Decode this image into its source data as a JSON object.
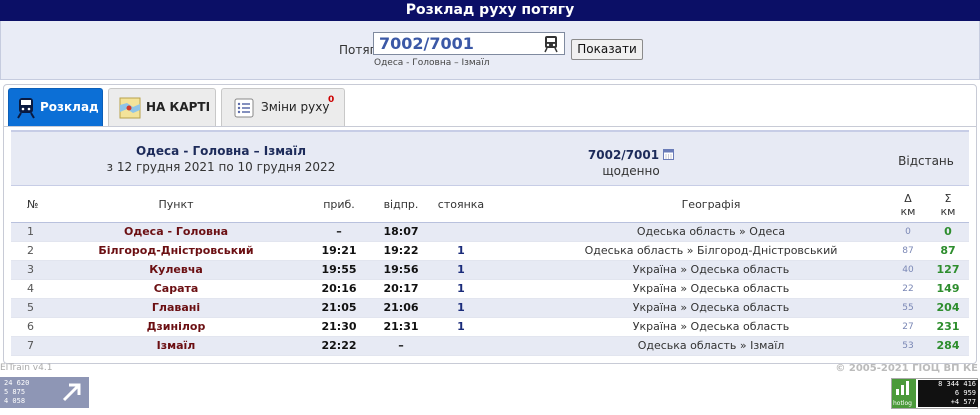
{
  "header": {
    "title": "Розклад руху потягу"
  },
  "search": {
    "label": "Потяг",
    "value": "7002/7001",
    "subtitle": "Одеса - Головна – Ізмаїл",
    "button": "Показати"
  },
  "tabs": [
    {
      "label": "Розклад",
      "icon": "train-icon",
      "active": true
    },
    {
      "label": "НА КАРТІ",
      "icon": "map-icon",
      "active": false
    },
    {
      "label": "Зміни руху",
      "icon": "list-icon",
      "active": false,
      "badge": "0"
    }
  ],
  "schedule": {
    "route": "Одеса - Головна – Ізмаїл",
    "period": "з 12 грудня 2021 по 10 грудня 2022",
    "train_number": "7002/7001",
    "frequency": "щоденно",
    "distance_header": "Відстань"
  },
  "columns": {
    "num": "№",
    "station": "Пункт",
    "arrival": "приб.",
    "departure": "відпр.",
    "stop": "стоянка",
    "geography": "Географія",
    "delta": "Δ",
    "delta_unit": "км",
    "sum": "Σ",
    "sum_unit": "км"
  },
  "rows": [
    {
      "n": "1",
      "station": "Одеса - Головна",
      "arr": "–",
      "dep": "18:07",
      "stop": "",
      "geo": "Одеська область » Одеса",
      "dkm": "0",
      "skm": "0"
    },
    {
      "n": "2",
      "station": "Білгород-Дністровський",
      "arr": "19:21",
      "dep": "19:22",
      "stop": "1",
      "geo": "Одеська область » Білгород-Дністровський",
      "dkm": "87",
      "skm": "87"
    },
    {
      "n": "3",
      "station": "Кулевча",
      "arr": "19:55",
      "dep": "19:56",
      "stop": "1",
      "geo": "Україна » Одеська область",
      "dkm": "40",
      "skm": "127"
    },
    {
      "n": "4",
      "station": "Сарата",
      "arr": "20:16",
      "dep": "20:17",
      "stop": "1",
      "geo": "Україна » Одеська область",
      "dkm": "22",
      "skm": "149"
    },
    {
      "n": "5",
      "station": "Главані",
      "arr": "21:05",
      "dep": "21:06",
      "stop": "1",
      "geo": "Україна » Одеська область",
      "dkm": "55",
      "skm": "204"
    },
    {
      "n": "6",
      "station": "Дзинілор",
      "arr": "21:30",
      "dep": "21:31",
      "stop": "1",
      "geo": "Україна » Одеська область",
      "dkm": "27",
      "skm": "231"
    },
    {
      "n": "7",
      "station": "Ізмаїл",
      "arr": "22:22",
      "dep": "–",
      "stop": "",
      "geo": "Одеська область » Ізмаїл",
      "dkm": "53",
      "skm": "284"
    }
  ],
  "footer": {
    "version": "EITrain v4.1",
    "copyright": "© 2005-2021 ГІОЦ ВП КЕ",
    "counter_left": [
      "24 620",
      "5 875",
      "4 058"
    ],
    "hotlog_label": "hotlog",
    "hotlog_stats": [
      "8 344 416",
      "6 959",
      "+4 577"
    ]
  },
  "colors": {
    "header_bg": "#0b0f66",
    "tab_active": "#0c6fd6",
    "station": "#6b0f12",
    "km_total": "#2d8d2d"
  }
}
